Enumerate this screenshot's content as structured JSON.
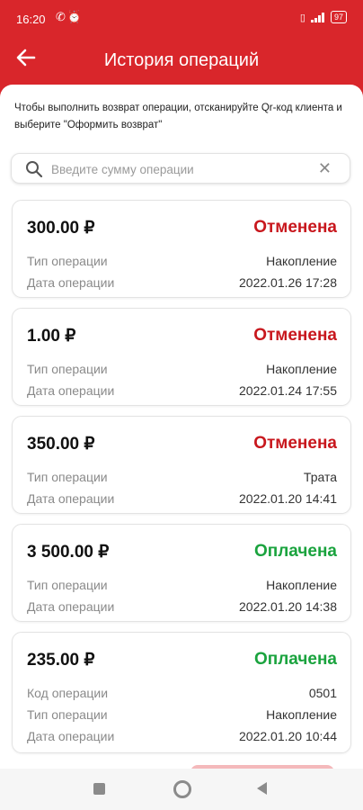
{
  "status_bar": {
    "time": "16:20",
    "status_icons": [
      "missed-call-icon",
      "alarm-icon"
    ],
    "right_icons": [
      "vibrate-icon",
      "signal-icon",
      "battery-icon"
    ],
    "battery": "97"
  },
  "header": {
    "title": "История операций",
    "back_icon": "arrow-left-icon"
  },
  "hint": "Чтобы выполнить возврат операции, отсканируйте Qr-код клиента и выберите \"Оформить возврат\"",
  "search": {
    "placeholder": "Введите сумму операции",
    "value": ""
  },
  "colors": {
    "brand": "#d9262b",
    "cancelled": "#c8171d",
    "paid": "#1aa33e"
  },
  "operations": [
    {
      "amount": "300.00 ₽",
      "status": "Отменена",
      "status_kind": "cancelled",
      "type_label": "Тип операции",
      "type": "Накопление",
      "date_label": "Дата операции",
      "date": "2022.01.26 17:28"
    },
    {
      "amount": "1.00 ₽",
      "status": "Отменена",
      "status_kind": "cancelled",
      "type_label": "Тип операции",
      "type": "Накопление",
      "date_label": "Дата операции",
      "date": "2022.01.24 17:55"
    },
    {
      "amount": "350.00 ₽",
      "status": "Отменена",
      "status_kind": "cancelled",
      "type_label": "Тип операции",
      "type": "Трата",
      "date_label": "Дата операции",
      "date": "2022.01.20 14:41"
    },
    {
      "amount": "3 500.00 ₽",
      "status": "Оплачена",
      "status_kind": "paid",
      "type_label": "Тип операции",
      "type": "Накопление",
      "date_label": "Дата операции",
      "date": "2022.01.20 14:38"
    },
    {
      "amount": "235.00 ₽",
      "status": "Оплачена",
      "status_kind": "paid",
      "code_label": "Код операции",
      "code": "0501",
      "type_label": "Тип операции",
      "type": "Накопление",
      "date_label": "Дата операции",
      "date": "2022.01.20 10:44"
    }
  ]
}
